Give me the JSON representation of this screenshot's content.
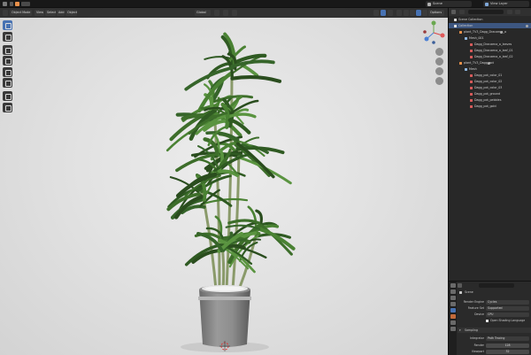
{
  "topbar": {
    "scene_name": "Scene",
    "view_layer": "View Layer"
  },
  "viewport": {
    "mode": "Object Mode",
    "menus": [
      "View",
      "Select",
      "Add",
      "Object"
    ],
    "transform": "Global",
    "options": "Options",
    "info_lines": [
      "",
      "",
      ""
    ]
  },
  "outliner": {
    "title": "Scene Collection",
    "rows": [
      {
        "label": "Collection",
        "level": 0,
        "type": "collection",
        "selected": true
      },
      {
        "label": "plant_TV3_Dagg_Dracaena_a",
        "level": 1,
        "type": "object"
      },
      {
        "label": "Mesh_001",
        "level": 2,
        "type": "mesh"
      },
      {
        "label": "Dagg_Dracaena_a_leaves",
        "level": 3,
        "type": "material"
      },
      {
        "label": "Dagg_Dracaena_a_leaf_01",
        "level": 3,
        "type": "material"
      },
      {
        "label": "Dagg_Dracaena_a_leaf_02",
        "level": 3,
        "type": "material"
      },
      {
        "label": "plant_TV3_Dagg_pot",
        "level": 1,
        "type": "object"
      },
      {
        "label": "Mesh",
        "level": 2,
        "type": "mesh"
      },
      {
        "label": "Dagg_pot_color_01",
        "level": 3,
        "type": "material"
      },
      {
        "label": "Dagg_pot_color_02",
        "level": 3,
        "type": "material"
      },
      {
        "label": "Dagg_pot_color_03",
        "level": 3,
        "type": "material"
      },
      {
        "label": "Dagg_pot_ground",
        "level": 3,
        "type": "material"
      },
      {
        "label": "Dagg_pot_pebbles",
        "level": 3,
        "type": "material"
      },
      {
        "label": "Dagg_pot_gold",
        "level": 3,
        "type": "material"
      }
    ]
  },
  "properties": {
    "context": "Scene",
    "render_engine_label": "Render Engine",
    "render_engine": "Cycles",
    "feature_set_label": "Feature Set",
    "feature_set": "Supported",
    "device_label": "Device",
    "device": "CPU",
    "osl_label": "Open Shading Language",
    "sampling_label": "Sampling",
    "integrator_label": "Integrator",
    "integrator": "Path Tracing",
    "render_label": "Render",
    "render_samples": "128",
    "viewport_label": "Viewport",
    "viewport_samples": "32"
  },
  "colors": {
    "accent": "#4772b3",
    "object_orange": "#e8904a",
    "material_red": "#d65a5a",
    "collection_white": "#e0e0e0"
  }
}
